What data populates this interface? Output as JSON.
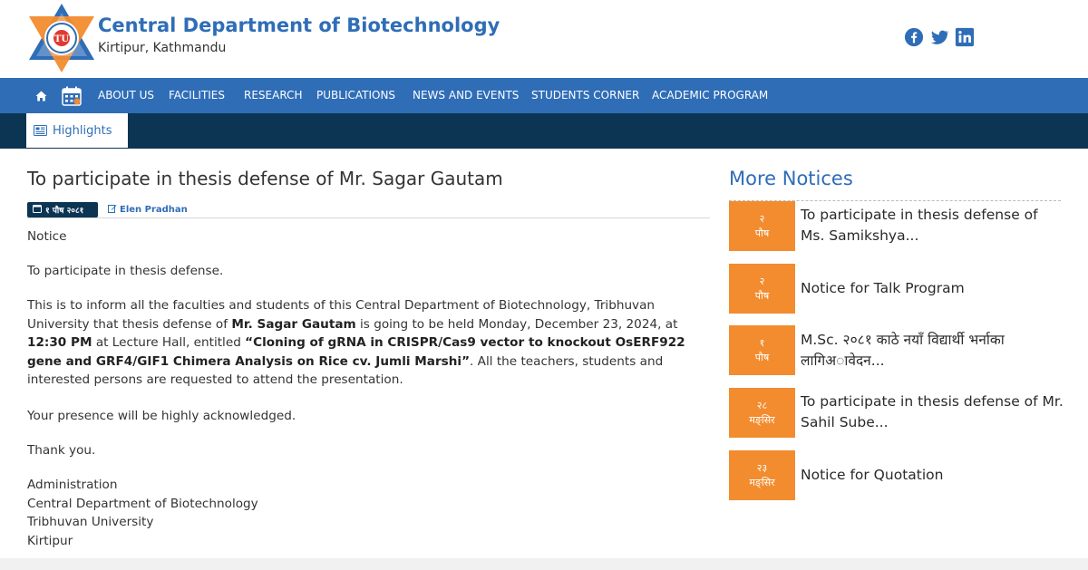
{
  "header": {
    "site_title": "Central Department of Biotechnology",
    "site_subtitle": "Kirtipur, Kathmandu",
    "logo": {
      "text": "TU",
      "ring_text": "KATHMANDU · NEPAL"
    },
    "social": [
      "facebook-icon",
      "twitter-icon",
      "linkedin-icon"
    ]
  },
  "colors": {
    "brand_blue": "#2f6db7",
    "dark_navy": "#0c3554",
    "accent_orange": "#f28c2e"
  },
  "nav": {
    "icons": [
      "home-icon",
      "calendar-icon"
    ],
    "items": [
      "ABOUT US",
      "FACILITIES",
      "RESEARCH",
      "PUBLICATIONS",
      "NEWS AND EVENTS",
      "STUDENTS CORNER",
      "ACADEMIC PROGRAM"
    ]
  },
  "subnav": {
    "highlights_label": "Highlights"
  },
  "article": {
    "title": "To participate in thesis defense of Mr. Sagar Gautam",
    "date": "१ पौष २०८१",
    "author": "Elen Pradhan",
    "p1": "Notice",
    "p2": "To participate in thesis defense.",
    "p3_part1": "This is to inform all the faculties and students of this Central Department of Biotechnology, Tribhuvan University that thesis defense of ",
    "p3_name": "Mr. Sagar Gautam",
    "p3_part2": " is going to be held Monday, December 23, 2024, at ",
    "p3_time": "12:30 PM",
    "p3_part3": " at Lecture Hall, entitled ",
    "p3_topic": "“Cloning of gRNA in CRISPR/Cas9 vector to knockout OsERF922 gene and GRF4/GIF1 Chimera Analysis on Rice cv. Jumli Marshi”",
    "p3_part4": ". All the teachers, students and interested persons are requested to attend the presentation.",
    "p4": "Your presence will be highly acknowledged.",
    "p5": "Thank you.",
    "signature": {
      "line1": "Administration",
      "line2": "Central Department of Biotechnology",
      "line3": "Tribhuvan University",
      "line4": "Kirtipur"
    }
  },
  "sidebar": {
    "heading": "More Notices",
    "notices": [
      {
        "day": "२",
        "month": "पौष",
        "title": "To participate in thesis defense of Ms. Samikshya..."
      },
      {
        "day": "२",
        "month": "पौष",
        "title": "Notice for Talk Program"
      },
      {
        "day": "१",
        "month": "पौष",
        "title": "M.Sc. २०८१ काठे नयाँ विद्यार्थी भर्नाका लागिअावेदन..."
      },
      {
        "day": "२८",
        "month": "मङ्सिर",
        "title": "To participate in thesis defense of Mr. Sahil Sube..."
      },
      {
        "day": "२३",
        "month": "मङ्सिर",
        "title": "Notice for Quotation"
      }
    ]
  }
}
